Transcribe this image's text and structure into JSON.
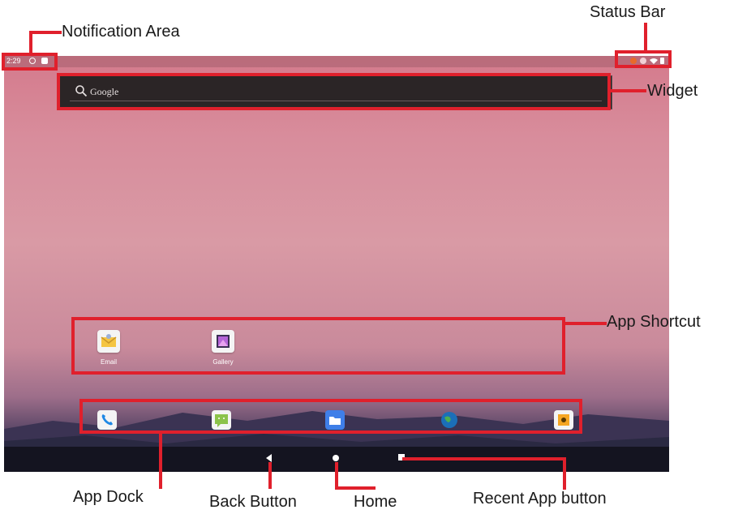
{
  "status_bar": {
    "time": "2:29",
    "left_icons": [
      "settings-icon",
      "notification-icon"
    ],
    "right_icons": [
      "alert-icon",
      "download-icon",
      "wifi-icon",
      "battery-icon"
    ]
  },
  "widget": {
    "search_placeholder": "Google"
  },
  "shortcuts": [
    {
      "label": "Email",
      "icon": "email-icon"
    },
    {
      "label": "Gallery",
      "icon": "gallery-icon"
    }
  ],
  "dock": [
    {
      "icon": "phone-icon"
    },
    {
      "icon": "messaging-icon"
    },
    {
      "icon": "files-icon"
    },
    {
      "icon": "browser-icon"
    },
    {
      "icon": "music-icon"
    }
  ],
  "nav": [
    "back-icon",
    "home-icon",
    "recent-apps-icon"
  ],
  "callouts": {
    "notification_area": "Notification Area",
    "status_bar": "Status Bar",
    "widget": "Widget",
    "app_shortcut": "App Shortcut",
    "app_dock": "App Dock",
    "back_button": "Back Button",
    "home": "Home",
    "recent_app_button": "Recent App button"
  },
  "colors": {
    "highlight": "#e0202c"
  }
}
